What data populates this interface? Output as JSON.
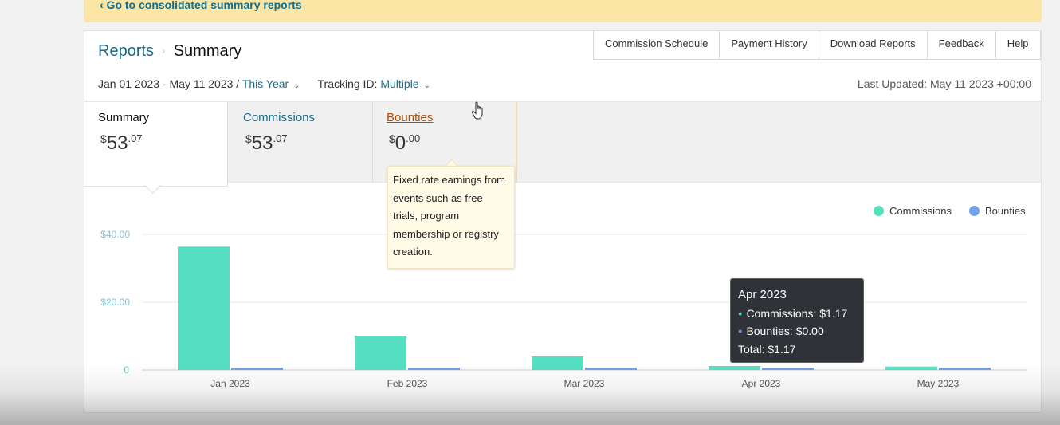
{
  "banner": {
    "link_text": "‹ Go to consolidated summary reports"
  },
  "breadcrumb": {
    "reports": "Reports",
    "separator": "›",
    "current": "Summary"
  },
  "top_tabs": [
    "Commission Schedule",
    "Payment History",
    "Download Reports",
    "Feedback",
    "Help"
  ],
  "filters": {
    "date_range": "Jan 01 2023 - May 11 2023 /",
    "period": "This Year",
    "tracking_label": "Tracking ID:",
    "tracking_value": "Multiple"
  },
  "last_updated": "Last Updated: May 11 2023 +00:00",
  "metrics": [
    {
      "label": "Summary",
      "currency": "$",
      "whole": "53",
      "cents": ".07"
    },
    {
      "label": "Commissions",
      "currency": "$",
      "whole": "53",
      "cents": ".07"
    },
    {
      "label": "Bounties",
      "currency": "$",
      "whole": "0",
      "cents": ".00"
    }
  ],
  "bounties_tooltip": "Fixed rate earnings from events such as free trials, program membership or registry creation.",
  "legend": [
    {
      "name": "Commissions",
      "color": "#55e0c2"
    },
    {
      "name": "Bounties",
      "color": "#74a2ea"
    }
  ],
  "hover_tooltip": {
    "title": "Apr 2023",
    "commissions": "Commissions: $1.17",
    "bounties": "Bounties: $0.00",
    "total": "Total: $1.17"
  },
  "chart_data": {
    "type": "bar",
    "categories": [
      "Jan 2023",
      "Feb 2023",
      "Mar 2023",
      "Apr 2023",
      "May 2023"
    ],
    "series": [
      {
        "name": "Commissions",
        "values": [
          36.4,
          10.1,
          4.0,
          1.17,
          1.0
        ],
        "color": "#55e0c2"
      },
      {
        "name": "Bounties",
        "values": [
          0,
          0,
          0,
          0,
          0
        ],
        "color": "#74a2ea"
      }
    ],
    "yticks": [
      "0",
      "$20.00",
      "$40.00"
    ],
    "ylim": [
      0,
      40
    ],
    "grid": true,
    "legend": "top-right"
  }
}
